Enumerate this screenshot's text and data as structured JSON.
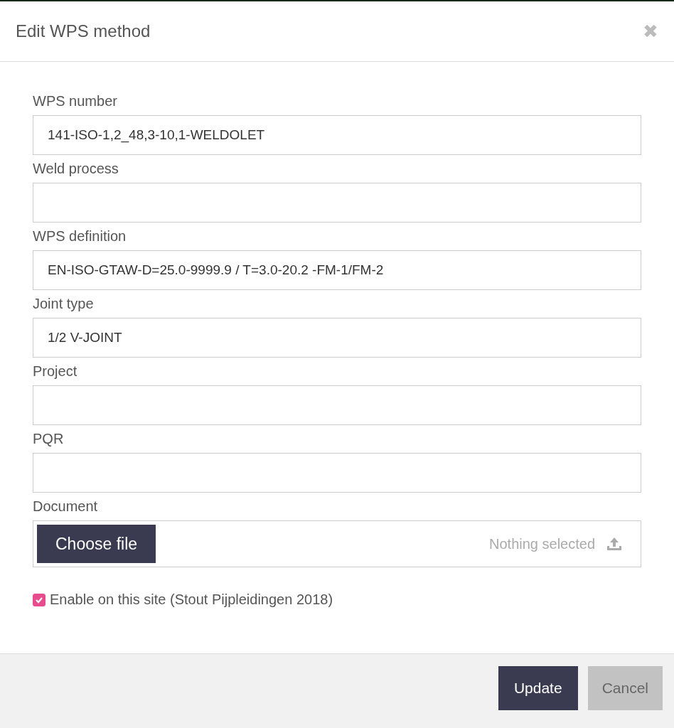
{
  "dialog": {
    "title": "Edit WPS method",
    "close_symbol": "✖"
  },
  "fields": [
    {
      "label": "WPS number",
      "value": "141-ISO-1,2_48,3-10,1-WELDOLET"
    },
    {
      "label": "Weld process"
    },
    {
      "label": "WPS definition",
      "value": "EN-ISO-GTAW-D=25.0-9999.9 / T=3.0-20.2 -FM-1/FM-2"
    },
    {
      "label": "Joint type",
      "value": "1/2 V-JOINT"
    },
    {
      "label": "Project"
    },
    {
      "label": "PQR"
    }
  ],
  "document": {
    "label": "Document",
    "button": "Choose file",
    "status": "Nothing selected"
  },
  "enable_checkbox": {
    "label": "Enable on this site (Stout Pijpleidingen 2018)",
    "checked": true
  },
  "buttons": [
    {
      "label": "Update",
      "kind": "primary"
    },
    {
      "label": "Cancel",
      "kind": "secondary"
    }
  ]
}
